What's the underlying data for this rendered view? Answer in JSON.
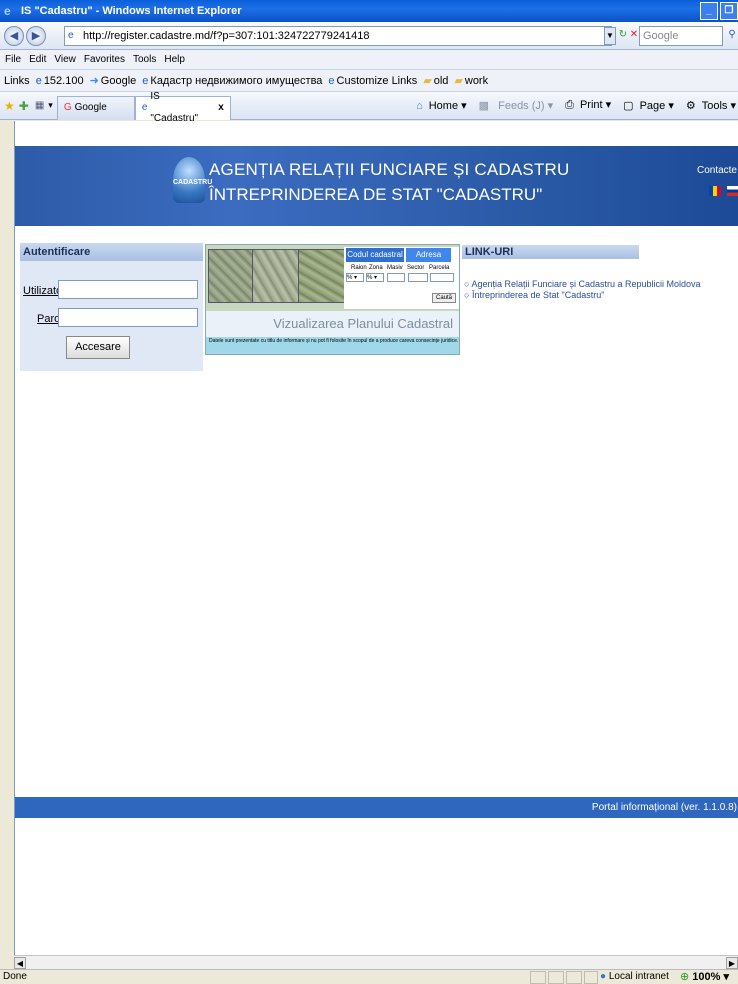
{
  "window": {
    "title": "IS \"Cadastru\" - Windows Internet Explorer",
    "address": "http://register.cadastre.md/f?p=307:101:324722779241418",
    "search_placeholder": "Google"
  },
  "menu": [
    "File",
    "Edit",
    "View",
    "Favorites",
    "Tools",
    "Help"
  ],
  "links_bar": {
    "label": "Links",
    "items": [
      "152.100",
      "Google",
      "Кадастр недвижимого имущества",
      "Customize Links",
      "old",
      "work"
    ]
  },
  "tabs": [
    {
      "label": "Google"
    },
    {
      "label": "IS \"Cadastru\""
    }
  ],
  "command_bar": {
    "home": "Home",
    "feeds": "Feeds (J)",
    "print": "Print",
    "page": "Page",
    "tools": "Tools"
  },
  "banner": {
    "logo_text": "CADASTRU",
    "line1": "AGENȚIA RELAȚII FUNCIARE ȘI CADASTRU",
    "line2": "ÎNTREPRINDEREA DE STAT \"CADASTRU\"",
    "contact": "Contacte"
  },
  "auth": {
    "title": "Autentificare",
    "user_label": "Utilizatorul",
    "pass_label": "Parola",
    "submit": "Accesare"
  },
  "map_widget": {
    "tab_code": "Codul cadastral",
    "tab_address": "Adresa",
    "fields": [
      "Raion",
      "Zona",
      "Masiv",
      "Sector",
      "Parcela"
    ],
    "search": "Caută",
    "caption": "Vizualizarea Planului Cadastral",
    "disclaimer": "Datele sunt prezentate cu titlu de informare și nu pot fi folosite în scopul de a produce careva consecințe juridice."
  },
  "links": {
    "title": "LINK-URI",
    "items": [
      "Agenția Relații Funciare și Cadastru a Republicii Moldova",
      "Întreprinderea de Stat \"Cadastru\""
    ]
  },
  "footer": "Portal informațional (ver. 1.1.0.8)",
  "status": {
    "left": "Done",
    "zone": "Local intranet",
    "zoom": "100%"
  }
}
